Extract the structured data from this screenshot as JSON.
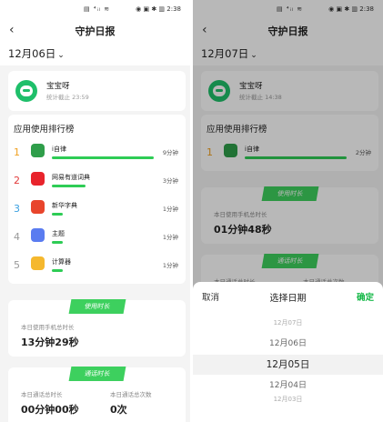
{
  "left": {
    "status_center": "▤ ⁴ᵢₗ ≋",
    "status_right": "◉ ▣ ✱ ▥ 2:38",
    "back": "‹",
    "title": "守护日报",
    "date": "12月06日",
    "date_chevron": "⌄",
    "profile": {
      "name": "宝宝呀",
      "sub": "统计截止 23:59"
    },
    "ranking": {
      "title": "应用使用排行榜",
      "items": [
        {
          "rank": "1",
          "name": "i自律",
          "time": "9分钟",
          "rank_color": "#f0a020",
          "icon_color": "#2f9e4a",
          "bar_fraction": 1.0
        },
        {
          "rank": "2",
          "name": "网易有道词典",
          "time": "3分钟",
          "rank_color": "#e23b3b",
          "icon_color": "#e8242c",
          "bar_fraction": 0.33
        },
        {
          "rank": "3",
          "name": "新华字典",
          "time": "1分钟",
          "rank_color": "#3aa0e0",
          "icon_color": "#e8452c",
          "bar_fraction": 0.11
        },
        {
          "rank": "4",
          "name": "主题",
          "time": "1分钟",
          "rank_color": "#999999",
          "icon_color": "#5a7cf0",
          "bar_fraction": 0.11
        },
        {
          "rank": "5",
          "name": "计算器",
          "time": "1分钟",
          "rank_color": "#999999",
          "icon_color": "#f5b82e",
          "bar_fraction": 0.11
        }
      ]
    },
    "usage": {
      "banner": "使用时长",
      "label": "本日使用手机总时长",
      "value": "13分钟29秒"
    },
    "call": {
      "banner": "通话时长",
      "label1": "本日通话总时长",
      "value1": "00分钟00秒",
      "label2": "本日通话总次数",
      "value2": "0次"
    }
  },
  "right": {
    "status_center": "▤ ⁴ᵢₗ ≋",
    "status_right": "◉ ▣ ✱ ▥ 2:38",
    "back": "‹",
    "title": "守护日报",
    "date": "12月07日",
    "date_chevron": "⌄",
    "profile": {
      "name": "宝宝呀",
      "sub": "统计截止 14:38"
    },
    "ranking": {
      "title": "应用使用排行榜",
      "items": [
        {
          "rank": "1",
          "name": "i自律",
          "time": "2分钟",
          "rank_color": "#f0a020",
          "icon_color": "#2f9e4a",
          "bar_fraction": 1.0
        }
      ]
    },
    "usage": {
      "banner": "使用时长",
      "label": "本日使用手机总时长",
      "value": "01分钟48秒"
    },
    "call": {
      "banner": "通话时长",
      "label1": "本日通话总时长",
      "label2": "本日通话总次数"
    },
    "picker": {
      "cancel": "取消",
      "title": "选择日期",
      "confirm": "确定",
      "options": [
        "12月07日",
        "12月06日",
        "12月05日",
        "12月04日",
        "12月03日"
      ],
      "selected": "12月05日"
    }
  },
  "colors": {
    "accent_green": "#2ecc55",
    "banner_green": "#3dd05e",
    "confirm_green": "#18b94a"
  }
}
